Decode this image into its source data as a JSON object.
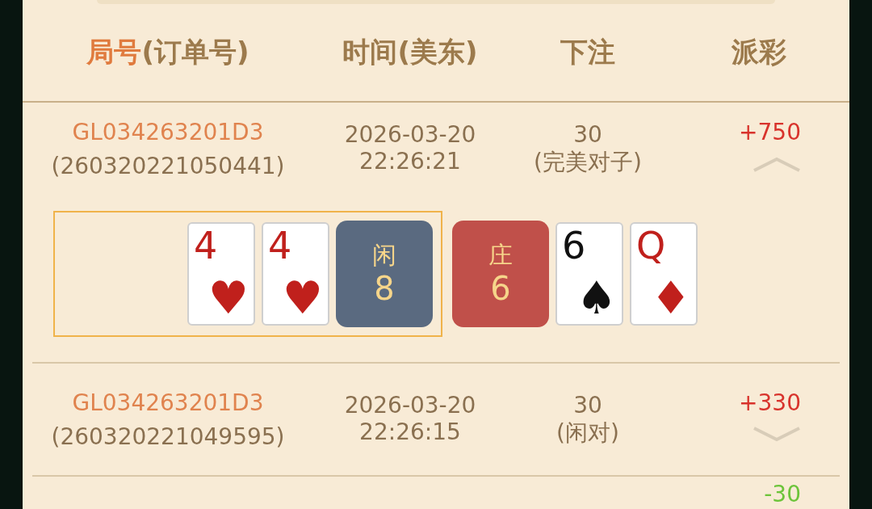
{
  "columns": [
    {
      "accent": "局号",
      "label": "(订单号)"
    },
    {
      "label": "时间(美东)"
    },
    {
      "label": "下注"
    },
    {
      "label": "派彩"
    }
  ],
  "rows": [
    {
      "round": "GL034263201D3",
      "order": "(260320221050441)",
      "date": "2026-03-20",
      "time": "22:26:21",
      "bet": "30",
      "bet_type": "(完美对子)",
      "payout": "+750",
      "color": "#d8332c",
      "expanded": true,
      "result": {
        "player": {
          "label": "闲",
          "total": "8",
          "highlighted": true,
          "cards": [
            {
              "rank": "4",
              "suit": "♥"
            },
            {
              "rank": "4",
              "suit": "♥"
            }
          ]
        },
        "banker": {
          "label": "庄",
          "total": "6",
          "cards": [
            {
              "rank": "6",
              "suit": "♠"
            },
            {
              "rank": "Q",
              "suit": "♦"
            }
          ]
        }
      }
    },
    {
      "round": "GL034263201D3",
      "order": "(260320221049595)",
      "date": "2026-03-20",
      "time": "22:26:15",
      "bet": "30",
      "bet_type": "(闲对)",
      "payout": "+330",
      "color": "#d8332c",
      "expanded": false
    },
    {
      "payout": "-30",
      "color": "#6cc43a"
    }
  ]
}
